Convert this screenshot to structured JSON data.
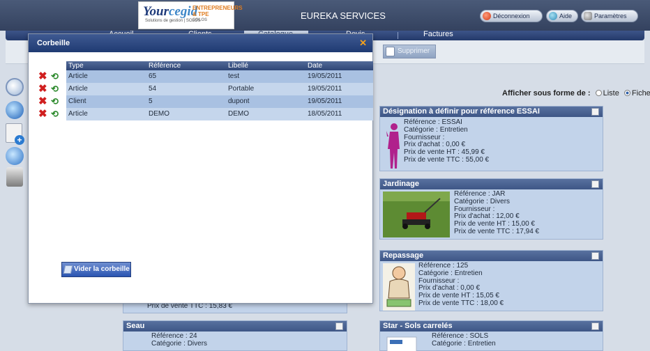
{
  "header": {
    "logo_text_a": "Your",
    "logo_text_b": "cegid",
    "logo_tag": "Solutions de gestion | SOLOS",
    "logo_side_1": "ENTREPRENEURS",
    "logo_side_2": "& TPE",
    "logo_side_3": "SOLOS",
    "app_title": "EUREKA SERVICES",
    "buttons": {
      "logout": "Déconnexion",
      "help": "Aide",
      "settings": "Paramètres"
    }
  },
  "nav": {
    "items": [
      "Accueil",
      "Clients",
      "Catalogue",
      "Devis",
      "Factures"
    ],
    "active": "Catalogue"
  },
  "toolbar": {
    "delete_label": "Supprimer"
  },
  "left_tools": [
    "search-icon",
    "compass-icon",
    "new-document-icon",
    "stats-icon",
    "trash-icon"
  ],
  "view": {
    "label": "Afficher sous forme de :",
    "option_list": "Liste",
    "option_card": "Fiche",
    "selected": "Fiche"
  },
  "catalog": {
    "essai": {
      "title": "Désignation à définir pour référence ESSAI",
      "lines": [
        "Référence : ESSAI",
        "Catégorie : Entretien",
        "Fournisseur :",
        "Prix d'achat : 0,00 €",
        "Prix de vente HT : 45,99 €",
        "Prix de vente TTC : 55,00 €"
      ]
    },
    "jar": {
      "title": "Jardinage",
      "lines": [
        "Référence : JAR",
        "Catégorie : Divers",
        "Fournisseur :",
        "Prix d'achat : 12,00 €",
        "Prix de vente HT : 15,00 €",
        "Prix de vente TTC : 17,94 €"
      ]
    },
    "rep": {
      "title": "Repassage",
      "lines": [
        "Référence : 125",
        "Catégorie : Entretien",
        "Fournisseur :",
        "Prix d'achat : 0,00 €",
        "Prix de vente HT : 15,05 €",
        "Prix de vente TTC : 18,00 €"
      ]
    },
    "star": {
      "title": "Star - Sols carrelés",
      "lines": [
        "Référence : SOLS",
        "Catégorie : Entretien"
      ]
    },
    "seau": {
      "title": "Seau",
      "lines": [
        "Référence : 24",
        "Catégorie : Divers"
      ]
    },
    "hidden_card_last_line": "Prix de vente TTC : 15,83 €"
  },
  "modal": {
    "title": "Corbeille",
    "columns": [
      "Type",
      "Référence",
      "Libellé",
      "Date"
    ],
    "rows": [
      {
        "type": "Article",
        "ref": "65",
        "label": "test",
        "date": "19/05/2011"
      },
      {
        "type": "Article",
        "ref": "54",
        "label": "Portable",
        "date": "19/05/2011"
      },
      {
        "type": "Client",
        "ref": "5",
        "label": "dupont",
        "date": "19/05/2011"
      },
      {
        "type": "Article",
        "ref": "DEMO",
        "label": "DEMO",
        "date": "18/05/2011"
      }
    ],
    "empty_button": "Vider la corbeille"
  }
}
